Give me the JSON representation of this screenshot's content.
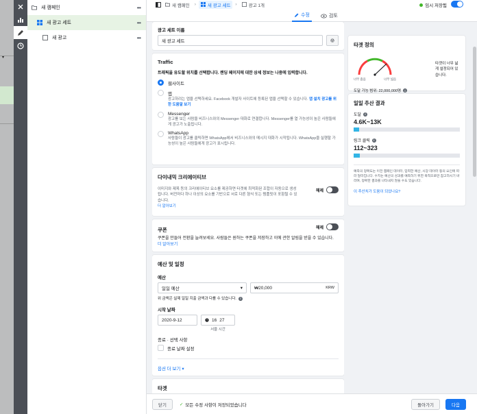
{
  "tree": {
    "campaign": "새 캠페인",
    "adset": "새 광고 세트",
    "ad": "새 광고"
  },
  "breadcrumb": {
    "campaign": "새 캠페인",
    "adset": "새 광고 세트",
    "ad": "광고 1개"
  },
  "save_status": "임시 저장됨",
  "modes": {
    "edit": "수정",
    "review": "검토"
  },
  "adset_name": {
    "label": "광고 세트 이름",
    "value": "새 광고 세트"
  },
  "traffic": {
    "title": "Traffic",
    "subtitle": "트래픽을 유도할 위치를 선택합니다. 랜딩 페이지에 대한 상세 정보는 나중에 입력합니다.",
    "options": [
      {
        "label": "웹사이트",
        "desc": "",
        "link": ""
      },
      {
        "label": "앱",
        "desc": "광고하려는 앱을 선택하세요. Facebook 개발자 사이트에 등록된 앱을 선택할 수 있습니다.",
        "link": "앱 설치 광고를 위한 도움말 보기"
      },
      {
        "label": "Messenger",
        "desc": "광고를 보는 사람을 비즈니스와의 Messenger 대화로 연결합니다. Messenger를 열 가능성이 높은 사람들에게 광고가 노출됩니다.",
        "link": ""
      },
      {
        "label": "WhatsApp",
        "desc": "사람들이 광고를 클릭하면 WhatsApp에서 비즈니스와의 메시지 대화가 시작됩니다. WhatsApp을 실행할 가능성이 높은 사람들에게 광고가 표시됩니다.",
        "link": ""
      }
    ]
  },
  "dynamic": {
    "title": "다이내믹 크리에이티브",
    "desc": "이미지와 제목 등의 크리에이티브 요소를 제공하면 타겟에 최적화된 조합이 자동으로 생성됩니다. 버전마다 하나 이상의 요소를 기반으로 서로 다른 형식 또는 템플릿이 포함될 수 있습니다.",
    "link": "더 알아보기",
    "toggle_label": "해제"
  },
  "coupon": {
    "title": "쿠폰",
    "toggle_label": "해제",
    "desc": "쿠폰을 만들어 전환을 늘려보세요. 사람들은 원하는 쿠폰을 저장하고 이에 관한 알림을 받을 수 있습니다.",
    "link": "더 알아보기"
  },
  "budget": {
    "title": "예산 및 일정",
    "budget_label": "예산",
    "budget_type": "일일 예산",
    "amount": "₩20,000",
    "currency": "KRW",
    "note": "위 금액은 실제 일일 지출 금액과 다를 수 있습니다.",
    "start_label": "시작 날짜",
    "start_date": "2020-9-12",
    "start_hour": "16",
    "start_minute": "27",
    "tz_label": "서울 시간",
    "end_label": "종료 · 선택 사항",
    "end_checkbox": "종료 날짜 설정",
    "more_options": "옵션 더 보기 ▾"
  },
  "target_section": {
    "title": "타겟"
  },
  "target_def": {
    "title": "타겟 정의",
    "desc": "타겟이 너무 넓게 설정되어 있습니다.",
    "narrow": "너무 좁음",
    "broad": "너무 넓음",
    "reach_label": "도달 가능 범위: 22,000,000명"
  },
  "estimate": {
    "title": "일일 추산 결과",
    "reach_label": "도달",
    "reach_value": "4.6K~13K",
    "reach_fill": 0.05,
    "click_label": "링크 클릭",
    "click_value": "112~323",
    "click_fill": 0.06,
    "desc": "예측의 정확도는 이전 캠페인 데이터, 입력한 예산, 시장 데이터 등의 요인에 따라 달라집니다. 수치는 예산의 성과를 예측하기 위한 목적으로만 참고하시기 바라며, 정확한 결과를 나타내지 않을 수도 있습니다.",
    "helpful": "이 추산치가 도움이 되었나요?"
  },
  "footer": {
    "close": "닫기",
    "saved": "모든 수정 사항이 저장되었습니다",
    "back": "돌아가기",
    "next": "다음"
  }
}
